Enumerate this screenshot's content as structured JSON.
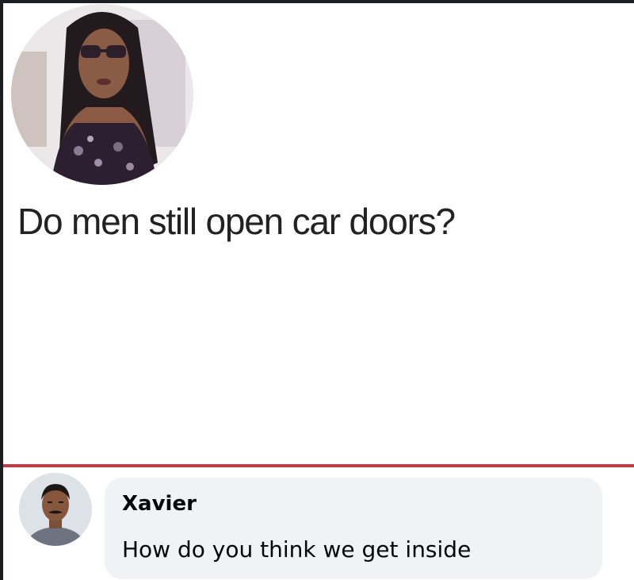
{
  "post": {
    "avatar_icon": "user-profile-photo",
    "text": "Do men still open car doors?"
  },
  "divider_color": "#c63a46",
  "comment": {
    "avatar_icon": "user-profile-photo",
    "author": "Xavier",
    "text": "How do you think we get inside"
  }
}
